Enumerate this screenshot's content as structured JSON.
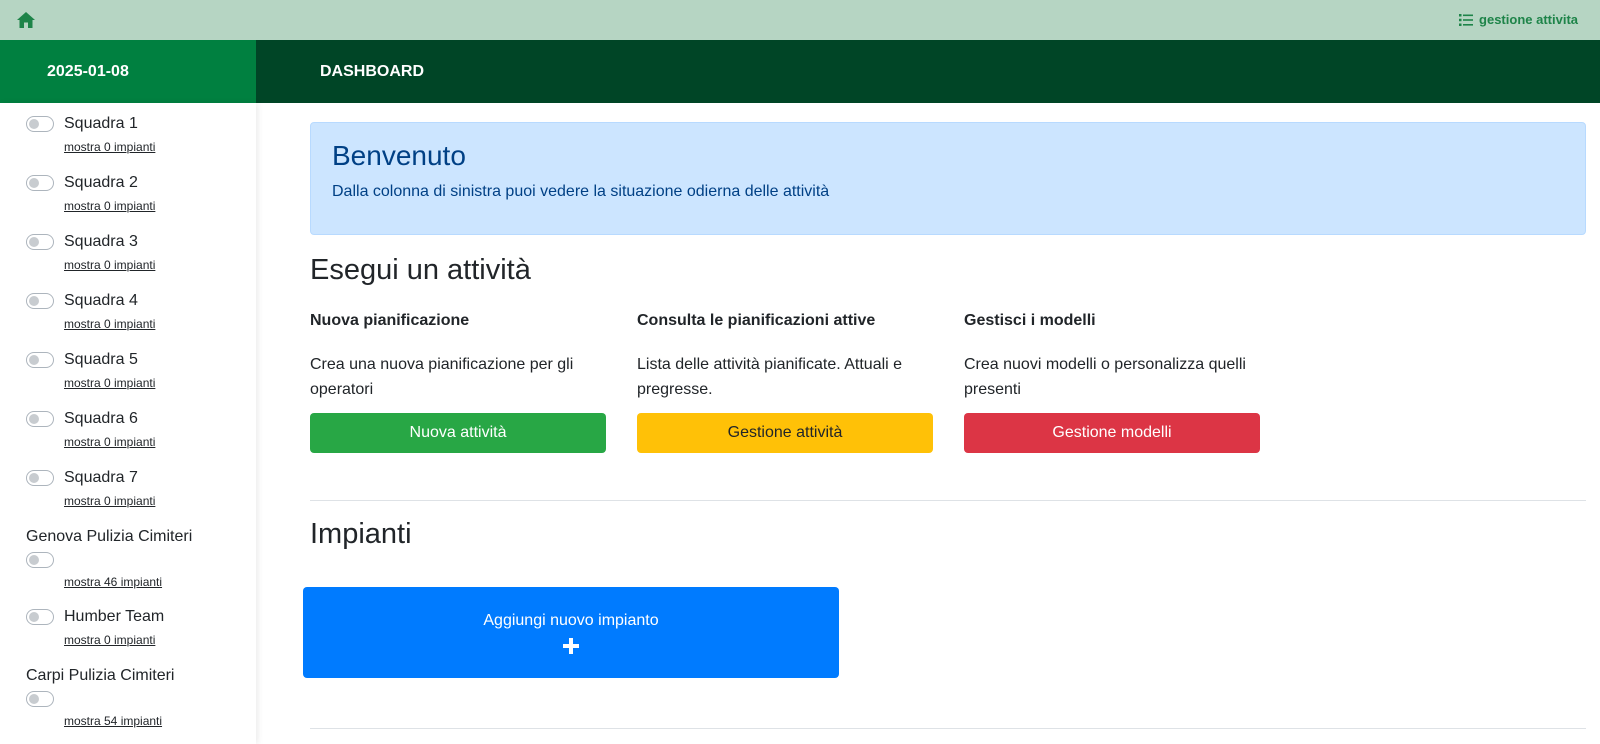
{
  "topbar": {
    "home_icon": "home-icon",
    "link_label": "gestione attivita",
    "link_icon": "list-icon"
  },
  "header": {
    "date": "2025-01-08",
    "title": "DASHBOARD"
  },
  "sidebar": {
    "teams": [
      {
        "name": "Squadra 1",
        "link": "mostra 0 impianti"
      },
      {
        "name": "Squadra 2",
        "link": "mostra 0 impianti"
      },
      {
        "name": "Squadra 3",
        "link": "mostra 0 impianti"
      },
      {
        "name": "Squadra 4",
        "link": "mostra 0 impianti"
      },
      {
        "name": "Squadra 5",
        "link": "mostra 0 impianti"
      },
      {
        "name": "Squadra 6",
        "link": "mostra 0 impianti"
      },
      {
        "name": "Squadra 7",
        "link": "mostra 0 impianti"
      },
      {
        "name": "Genova Pulizia Cimiteri",
        "link": "mostra 46 impianti"
      },
      {
        "name": "Humber Team",
        "link": "mostra 0 impianti"
      },
      {
        "name": "Carpi Pulizia Cimiteri",
        "link": "mostra 54 impianti"
      }
    ]
  },
  "welcome": {
    "title": "Benvenuto",
    "text": "Dalla colonna di sinistra puoi vedere la situazione odierna delle attività"
  },
  "activities": {
    "title": "Esegui un attività",
    "cards": [
      {
        "title": "Nuova pianificazione",
        "text": "Crea una nuova pianificazione per gli operatori",
        "button": "Nuova attività",
        "color": "#28a745"
      },
      {
        "title": "Consulta le pianificazioni attive",
        "text": "Lista delle attività pianificate. Attuali e pregresse.",
        "button": "Gestione attività",
        "color": "#ffc107"
      },
      {
        "title": "Gestisci i modelli",
        "text": "Crea nuovi modelli o personalizza quelli presenti",
        "button": "Gestione modelli",
        "color": "#dc3545"
      }
    ]
  },
  "plants": {
    "title": "Impianti",
    "add_label": "Aggiungi nuovo impianto",
    "add_icon": "plus-icon"
  },
  "colors": {
    "topbar": "#b6d5c3",
    "header_date": "#008040",
    "header_main": "#004526",
    "primary": "#007bff"
  }
}
